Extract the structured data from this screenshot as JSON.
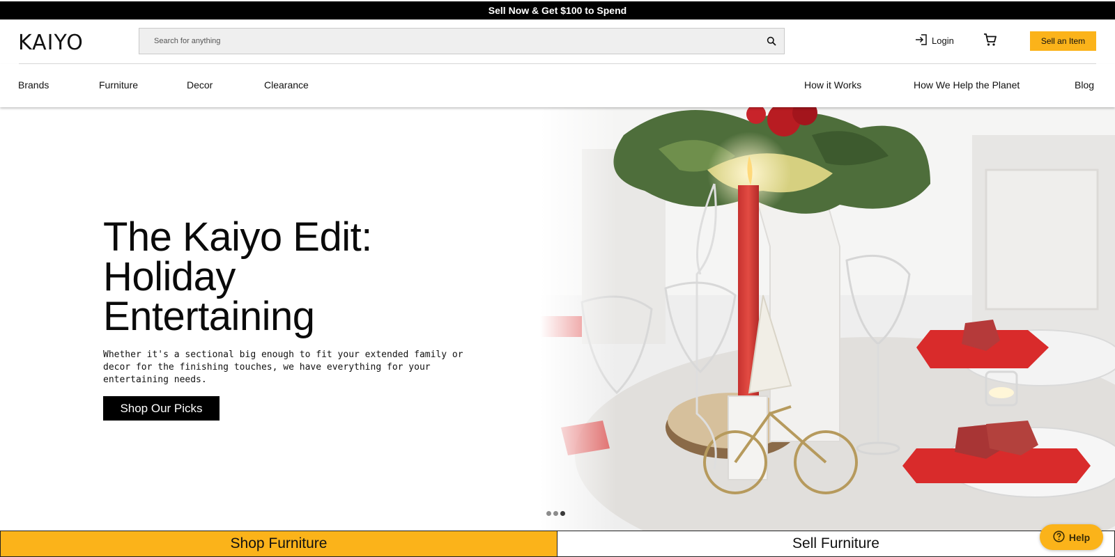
{
  "promo": {
    "text": "Sell Now & Get $100 to Spend"
  },
  "header": {
    "logo": "KAIYO",
    "search_placeholder": "Search for anything",
    "login_label": "Login",
    "sell_label": "Sell an Item"
  },
  "nav": {
    "left": [
      "Brands",
      "Furniture",
      "Decor",
      "Clearance"
    ],
    "right": [
      "How it Works",
      "How We Help the Planet",
      "Blog"
    ]
  },
  "hero": {
    "title_lines": [
      "The Kaiyo Edit:",
      "Holiday",
      "Entertaining"
    ],
    "description": "Whether it's a sectional big enough to fit your extended family or decor for the finishing touches, we have everything for your entertaining needs.",
    "button_label": "Shop Our Picks",
    "slide_count": 3,
    "active_slide": 3
  },
  "cta": {
    "left": "Shop Furniture",
    "right": "Sell Furniture"
  },
  "help": {
    "label": "Help"
  },
  "colors": {
    "accent": "#fbb31a",
    "dark": "#000000"
  }
}
